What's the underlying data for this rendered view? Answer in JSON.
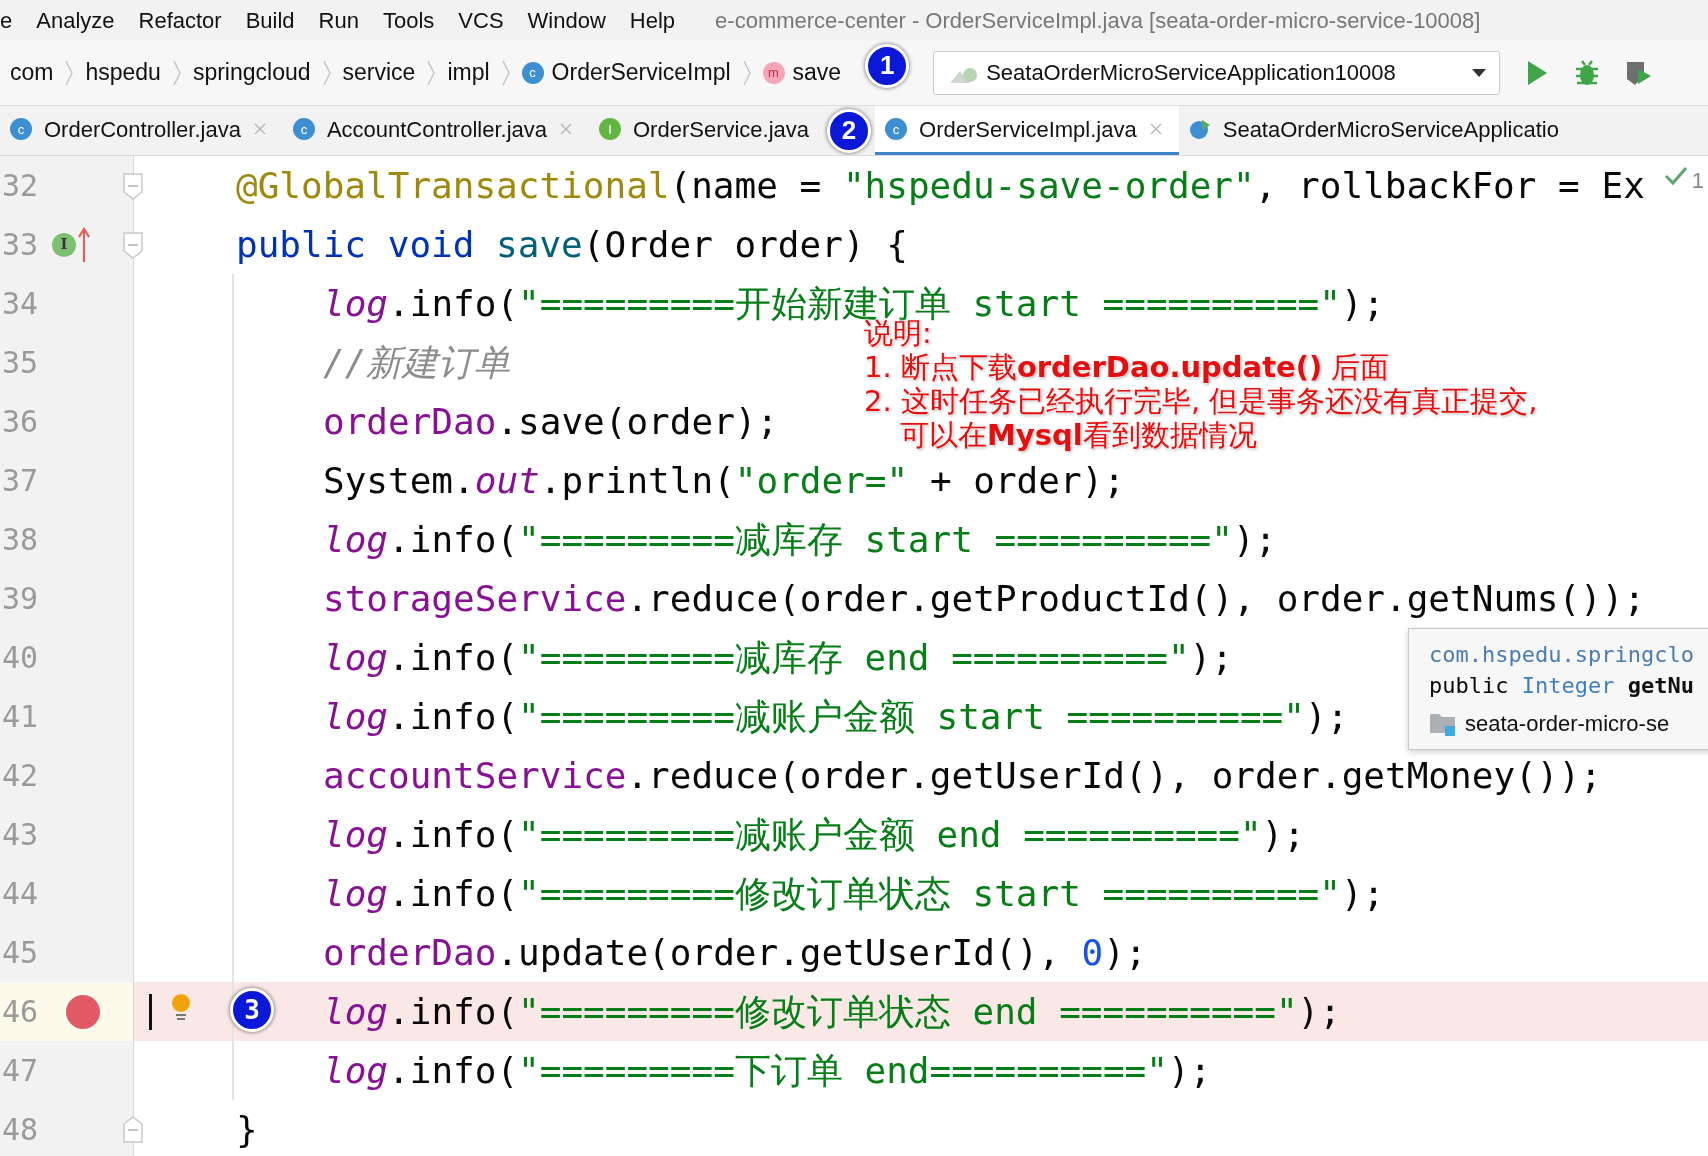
{
  "menu_bar": {
    "items": [
      "e",
      "Analyze",
      "Refactor",
      "Build",
      "Run",
      "Tools",
      "VCS",
      "Window",
      "Help"
    ],
    "title": "e-commerce-center - OrderServiceImpl.java [seata-order-micro-service-10008]"
  },
  "breadcrumbs": [
    {
      "label": "com",
      "kind": "package"
    },
    {
      "label": "hspedu",
      "kind": "package"
    },
    {
      "label": "springcloud",
      "kind": "package"
    },
    {
      "label": "service",
      "kind": "package"
    },
    {
      "label": "impl",
      "kind": "package"
    },
    {
      "label": "OrderServiceImpl",
      "kind": "class",
      "icon_letter": "c"
    },
    {
      "label": "save",
      "kind": "method",
      "icon_letter": "m"
    }
  ],
  "run_config": {
    "label": "SeataOrderMicroServiceApplication10008"
  },
  "tabs": [
    {
      "label": "OrderController.java",
      "kind": "class",
      "icon_letter": "c",
      "selected": false,
      "closable": true
    },
    {
      "label": "AccountController.java",
      "kind": "class",
      "icon_letter": "c",
      "selected": false,
      "closable": true
    },
    {
      "label": "OrderService.java",
      "kind": "interface",
      "icon_letter": "I",
      "selected": false,
      "closable": false
    },
    {
      "label": "OrderServiceImpl.java",
      "kind": "class",
      "icon_letter": "c",
      "selected": true,
      "closable": true
    },
    {
      "label": "SeataOrderMicroServiceApplicatio",
      "kind": "app",
      "selected": false,
      "closable": false
    }
  ],
  "code_lines": [
    {
      "number": "32",
      "kind": "annotation",
      "foldable": true,
      "tokens": [
        {
          "text": "@GlobalTransactional",
          "kind": "ann"
        },
        {
          "text": "(name = ",
          "kind": "plain"
        },
        {
          "text": "\"hspedu-save-order\"",
          "kind": "str"
        },
        {
          "text": ", rollbackFor = Ex",
          "kind": "plain"
        }
      ],
      "inspection": "1"
    },
    {
      "number": "33",
      "kind": "signature",
      "foldable": true,
      "implements": true,
      "gutter_letter": "I",
      "tokens": [
        {
          "text": "public void ",
          "kind": "kw"
        },
        {
          "text": "save",
          "kind": "decl"
        },
        {
          "text": "(Order order) {",
          "kind": "plain"
        }
      ]
    },
    {
      "number": "34",
      "kind": "statement",
      "tokens": [
        {
          "text": "log",
          "kind": "static"
        },
        {
          "text": ".info(",
          "kind": "plain"
        },
        {
          "text": "\"=========开始新建订单 start ==========\"",
          "kind": "str"
        },
        {
          "text": ");",
          "kind": "plain"
        }
      ]
    },
    {
      "number": "35",
      "kind": "statement",
      "tokens": [
        {
          "text": "//新建订单",
          "kind": "comment"
        }
      ]
    },
    {
      "number": "36",
      "kind": "statement",
      "tokens": [
        {
          "text": "orderDao",
          "kind": "field"
        },
        {
          "text": ".save(order);",
          "kind": "plain"
        }
      ]
    },
    {
      "number": "37",
      "kind": "statement",
      "tokens": [
        {
          "text": "System.",
          "kind": "plain"
        },
        {
          "text": "out",
          "kind": "static"
        },
        {
          "text": ".println(",
          "kind": "plain"
        },
        {
          "text": "\"order=\"",
          "kind": "str"
        },
        {
          "text": " + order);",
          "kind": "plain"
        }
      ]
    },
    {
      "number": "38",
      "kind": "statement",
      "tokens": [
        {
          "text": "log",
          "kind": "static"
        },
        {
          "text": ".info(",
          "kind": "plain"
        },
        {
          "text": "\"=========减库存 start ==========\"",
          "kind": "str"
        },
        {
          "text": ");",
          "kind": "plain"
        }
      ]
    },
    {
      "number": "39",
      "kind": "statement",
      "tokens": [
        {
          "text": "storageService",
          "kind": "field"
        },
        {
          "text": ".reduce(order.getProductId(), order.getNums());",
          "kind": "plain"
        }
      ]
    },
    {
      "number": "40",
      "kind": "statement",
      "tokens": [
        {
          "text": "log",
          "kind": "static"
        },
        {
          "text": ".info(",
          "kind": "plain"
        },
        {
          "text": "\"=========减库存 end ==========\"",
          "kind": "str"
        },
        {
          "text": ");",
          "kind": "plain"
        }
      ]
    },
    {
      "number": "41",
      "kind": "statement",
      "tokens": [
        {
          "text": "log",
          "kind": "static"
        },
        {
          "text": ".info(",
          "kind": "plain"
        },
        {
          "text": "\"=========减账户金额 start ==========\"",
          "kind": "str"
        },
        {
          "text": ");",
          "kind": "plain"
        }
      ]
    },
    {
      "number": "42",
      "kind": "statement",
      "tokens": [
        {
          "text": "accountService",
          "kind": "field"
        },
        {
          "text": ".reduce(order.getUserId(), order.getMoney());",
          "kind": "plain"
        }
      ]
    },
    {
      "number": "43",
      "kind": "statement",
      "tokens": [
        {
          "text": "log",
          "kind": "static"
        },
        {
          "text": ".info(",
          "kind": "plain"
        },
        {
          "text": "\"=========减账户金额 end ==========\"",
          "kind": "str"
        },
        {
          "text": ");",
          "kind": "plain"
        }
      ]
    },
    {
      "number": "44",
      "kind": "statement",
      "tokens": [
        {
          "text": "log",
          "kind": "static"
        },
        {
          "text": ".info(",
          "kind": "plain"
        },
        {
          "text": "\"=========修改订单状态 start ==========\"",
          "kind": "str"
        },
        {
          "text": ");",
          "kind": "plain"
        }
      ]
    },
    {
      "number": "45",
      "kind": "statement",
      "tokens": [
        {
          "text": "orderDao",
          "kind": "field"
        },
        {
          "text": ".update(order.getUserId(), ",
          "kind": "plain"
        },
        {
          "text": "0",
          "kind": "num"
        },
        {
          "text": ");",
          "kind": "plain"
        }
      ]
    },
    {
      "number": "46",
      "kind": "statement",
      "breakpoint": true,
      "current": true,
      "tokens": [
        {
          "text": "log",
          "kind": "static"
        },
        {
          "text": ".info(",
          "kind": "plain"
        },
        {
          "text": "\"=========修改订单状态 end ==========\"",
          "kind": "str"
        },
        {
          "text": ");",
          "kind": "plain"
        }
      ]
    },
    {
      "number": "47",
      "kind": "statement",
      "tokens": [
        {
          "text": "log",
          "kind": "static"
        },
        {
          "text": ".info(",
          "kind": "plain"
        },
        {
          "text": "\"=========下订单 end==========\"",
          "kind": "str"
        },
        {
          "text": ");",
          "kind": "plain"
        }
      ]
    },
    {
      "number": "48",
      "kind": "close",
      "foldable": true,
      "tokens": [
        {
          "text": "}",
          "kind": "plain"
        }
      ]
    }
  ],
  "doc_popup": {
    "lines": [
      [
        {
          "text": "com.hspedu.springclo",
          "kind": "link"
        }
      ],
      [
        {
          "text": "public ",
          "kind": "plain"
        },
        {
          "text": "Integer ",
          "kind": "type"
        },
        {
          "text": "getNu",
          "kind": "bold"
        }
      ]
    ],
    "module": "seata-order-micro-se"
  },
  "annotation": {
    "lines": [
      "说明:",
      "1. 断点下载**orderDao.update()** 后面",
      "2. 这时任务已经执行完毕, 但是事务还没有真正提交,",
      "可以在**Mysql**看到数据情况"
    ]
  },
  "step_badges": [
    "1",
    "2",
    "3"
  ]
}
